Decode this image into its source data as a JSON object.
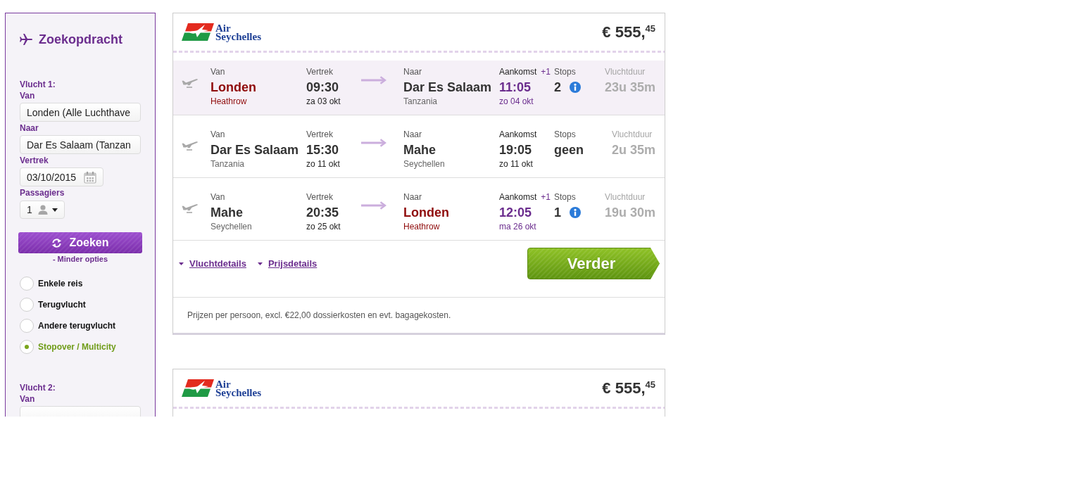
{
  "sidebar": {
    "title": "Zoekopdracht",
    "flight_1": {
      "heading": "Vlucht 1:",
      "fields": [
        {
          "label": "Van",
          "kind": "text",
          "value": "Londen (Alle Luchthave"
        },
        {
          "label": "Naar",
          "kind": "text",
          "value": "Dar Es Salaam (Tanzan"
        },
        {
          "label": "Vertrek",
          "kind": "date",
          "value": "03/10/2015"
        },
        {
          "label": "Passagiers",
          "kind": "passengers",
          "value": "1"
        }
      ]
    },
    "search_button": "Zoeken",
    "options_link": "- Minder opties",
    "trip_types": [
      {
        "label": "Enkele reis",
        "selected": false
      },
      {
        "label": "Terugvlucht",
        "selected": false
      },
      {
        "label": "Andere terugvlucht",
        "selected": false
      },
      {
        "label": "Stopover / Multicity",
        "selected": true
      }
    ],
    "flight_2": {
      "heading": "Vlucht 2:",
      "fields": [
        {
          "label": "Van",
          "kind": "text"
        }
      ]
    }
  },
  "results": [
    {
      "airline_logo": [
        "Air",
        "Seychelles"
      ],
      "price": "€ 555,$^{45}$",
      "segments": [
        {
          "highlighted": true,
          "from": {
            "label": "Van",
            "city": "Londen",
            "place": "Heathrow",
            "highlight": true
          },
          "departure": {
            "label": "Vertrek",
            "time": "09:30",
            "date": "za 03 okt"
          },
          "to": {
            "label": "Naar",
            "city": "Dar Es Salaam",
            "place": "Tanzania",
            "highlight": false
          },
          "arrival": {
            "label": "Aankomst",
            "day_offset": "+1",
            "time": "11:05",
            "date": "zo 04 okt"
          },
          "stops": {
            "label": "Stops",
            "value": "2",
            "info": true
          },
          "duration": {
            "label": "Vluchtduur",
            "value": "23u 35m"
          }
        },
        {
          "highlighted": false,
          "from": {
            "label": "Van",
            "city": "Dar Es Salaam",
            "place": "Tanzania",
            "highlight": false
          },
          "departure": {
            "label": "Vertrek",
            "time": "15:30",
            "date": "zo 11 okt"
          },
          "to": {
            "label": "Naar",
            "city": "Mahe",
            "place": "Seychellen",
            "highlight": false
          },
          "arrival": {
            "label": "Aankomst",
            "time": "19:05",
            "date": "zo 11 okt"
          },
          "stops": {
            "label": "Stops",
            "value": "geen",
            "info": false
          },
          "duration": {
            "label": "Vluchtduur",
            "value": "2u 35m"
          }
        },
        {
          "highlighted": false,
          "from": {
            "label": "Van",
            "city": "Mahe",
            "place": "Seychellen",
            "highlight": false
          },
          "departure": {
            "label": "Vertrek",
            "time": "20:35",
            "date": "zo 25 okt"
          },
          "to": {
            "label": "Naar",
            "city": "Londen",
            "place": "Heathrow",
            "highlight": true
          },
          "arrival": {
            "label": "Aankomst",
            "day_offset": "+1",
            "time": "12:05",
            "date": "ma 26 okt"
          },
          "stops": {
            "label": "Stops",
            "value": "1",
            "info": true
          },
          "duration": {
            "label": "Vluchtduur",
            "value": "19u 30m"
          }
        }
      ],
      "links": [
        "Vluchtdetails",
        "Prijsdetails"
      ],
      "button": "Verder",
      "note": "Prijzen per persoon, excl. €22,00 dossierkosten en evt. bagagekosten."
    },
    {
      "airline_logo": [
        "Air",
        "Seychelles"
      ],
      "price": "€ 555,$^{45}$"
    }
  ]
}
